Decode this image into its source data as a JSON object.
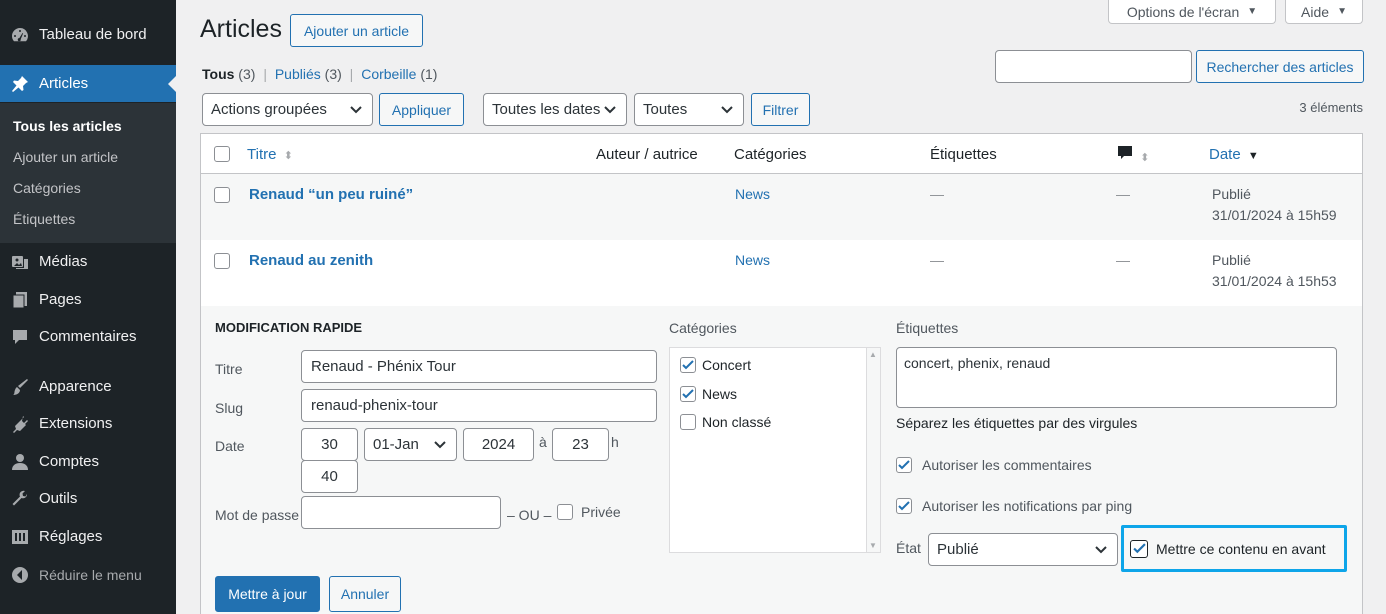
{
  "sidebar": {
    "dashboard": "Tableau de bord",
    "articles": "Articles",
    "submenu": [
      "Tous les articles",
      "Ajouter un article",
      "Catégories",
      "Étiquettes"
    ],
    "media": "Médias",
    "pages": "Pages",
    "comments": "Commentaires",
    "appearance": "Apparence",
    "plugins": "Extensions",
    "users": "Comptes",
    "tools": "Outils",
    "settings": "Réglages",
    "collapse": "Réduire le menu"
  },
  "header": {
    "title": "Articles",
    "add_new": "Ajouter un article",
    "screen_options": "Options de l'écran",
    "help": "Aide",
    "search_button": "Rechercher des articles",
    "search_value": ""
  },
  "filters": {
    "all": "Tous",
    "all_count": "(3)",
    "published": "Publiés",
    "published_count": "(3)",
    "trash": "Corbeille",
    "trash_count": "(1)",
    "sep": "|"
  },
  "tablenav": {
    "bulk_actions": "Actions groupées",
    "apply": "Appliquer",
    "dates": "Toutes les dates",
    "categories": "Toutes",
    "filter": "Filtrer",
    "item_count": "3 éléments"
  },
  "table": {
    "columns": {
      "title": "Titre",
      "author": "Auteur / autrice",
      "categories": "Catégories",
      "tags": "Étiquettes",
      "date": "Date"
    },
    "rows": [
      {
        "title": "Renaud “un peu ruiné”",
        "category": "News",
        "tags": "—",
        "comments": "—",
        "status": "Publié",
        "date": "31/01/2024 à 15h59"
      },
      {
        "title": "Renaud au zenith",
        "category": "News",
        "tags": "—",
        "comments": "—",
        "status": "Publié",
        "date": "31/01/2024 à 15h53"
      }
    ]
  },
  "quick_edit": {
    "heading": "Modification rapide",
    "title_label": "Titre",
    "title_value": "Renaud - Phénix Tour",
    "slug_label": "Slug",
    "slug_value": "renaud-phenix-tour",
    "date_label": "Date",
    "day": "30",
    "month": "01-Jan",
    "year": "2024",
    "at": "à",
    "hour": "23",
    "h": "h",
    "minute": "40",
    "password_label": "Mot de passe",
    "or": "– OU –",
    "private": "Privée",
    "categories_label": "Catégories",
    "categories": [
      {
        "name": "Concert",
        "checked": true
      },
      {
        "name": "News",
        "checked": true
      },
      {
        "name": "Non classé",
        "checked": false
      }
    ],
    "tags_label": "Étiquettes",
    "tags_value": "concert, phenix, renaud",
    "tags_hint": "Séparez les étiquettes par des virgules",
    "allow_comments": "Autoriser les commentaires",
    "allow_pings": "Autoriser les notifications par ping",
    "status_label": "État",
    "status_value": "Publié",
    "sticky": "Mettre ce contenu en avant",
    "update": "Mettre à jour",
    "cancel": "Annuler"
  },
  "colors": {
    "accent": "#2271b1",
    "sidebar": "#1d2327",
    "highlight": "#0ea5e9"
  }
}
